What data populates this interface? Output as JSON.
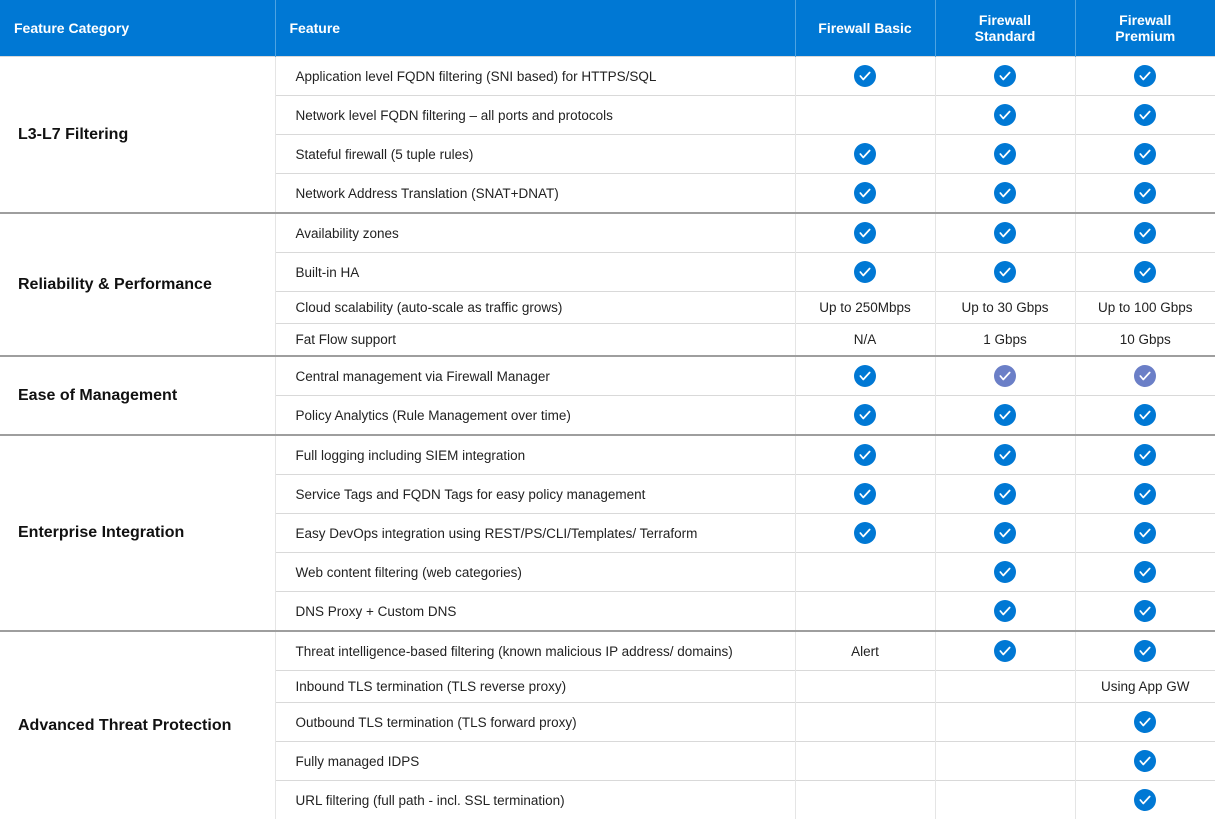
{
  "headers": {
    "category": "Feature Category",
    "feature": "Feature",
    "tier_basic": "Firewall Basic",
    "tier_standard": "Firewall Standard",
    "tier_premium": "Firewall Premium"
  },
  "groups": [
    {
      "category": "L3-L7 Filtering",
      "rows": [
        {
          "feature": "Application level FQDN filtering (SNI based) for HTTPS/SQL",
          "basic": "check",
          "standard": "check",
          "premium": "check"
        },
        {
          "feature": "Network level FQDN filtering – all ports and protocols",
          "basic": "",
          "standard": "check",
          "premium": "check"
        },
        {
          "feature": "Stateful firewall (5 tuple rules)",
          "basic": "check",
          "standard": "check",
          "premium": "check"
        },
        {
          "feature": "Network Address Translation (SNAT+DNAT)",
          "basic": "check",
          "standard": "check",
          "premium": "check"
        }
      ]
    },
    {
      "category": "Reliability & Performance",
      "rows": [
        {
          "feature": "Availability zones",
          "basic": "check",
          "standard": "check",
          "premium": "check"
        },
        {
          "feature": "Built-in  HA",
          "basic": "check",
          "standard": "check",
          "premium": "check"
        },
        {
          "feature": "Cloud scalability (auto-scale as traffic grows)",
          "basic": "Up to 250Mbps",
          "standard": "Up to 30 Gbps",
          "premium": "Up to 100 Gbps"
        },
        {
          "feature": " Fat Flow support",
          "basic": "N/A",
          "standard": "1 Gbps",
          "premium": "10 Gbps"
        }
      ]
    },
    {
      "category": "Ease of Management",
      "rows": [
        {
          "feature": "Central management via Firewall Manager",
          "basic": "check",
          "standard": "check-alt",
          "premium": "check-alt"
        },
        {
          "feature": "Policy Analytics  (Rule Management over time)",
          "basic": "check",
          "standard": "check",
          "premium": "check"
        }
      ]
    },
    {
      "category": "Enterprise Integration",
      "rows": [
        {
          "feature": "Full logging including SIEM integration",
          "basic": "check",
          "standard": "check",
          "premium": "check"
        },
        {
          "feature": "Service Tags and FQDN Tags for easy policy management",
          "basic": "check",
          "standard": "check",
          "premium": "check"
        },
        {
          "feature": "Easy DevOps integration using REST/PS/CLI/Templates/ Terraform",
          "basic": "check",
          "standard": "check",
          "premium": "check"
        },
        {
          "feature": "Web content filtering (web categories)",
          "basic": "",
          "standard": "check",
          "premium": "check"
        },
        {
          "feature": "DNS Proxy + Custom DNS",
          "basic": "",
          "standard": "check",
          "premium": "check"
        }
      ]
    },
    {
      "category": "Advanced Threat Protection",
      "rows": [
        {
          "feature": "Threat intelligence-based filtering (known malicious IP address/ domains)",
          "basic": "Alert",
          "standard": "check",
          "premium": "check"
        },
        {
          "feature": "Inbound TLS termination (TLS reverse proxy)",
          "basic": "",
          "standard": "",
          "premium": "Using App GW"
        },
        {
          "feature": "Outbound TLS termination (TLS forward proxy)",
          "basic": "",
          "standard": "",
          "premium": "check"
        },
        {
          "feature": "Fully managed IDPS",
          "basic": "",
          "standard": "",
          "premium": "check"
        },
        {
          "feature": "URL filtering (full path - incl. SSL termination)",
          "basic": "",
          "standard": "",
          "premium": "check"
        }
      ]
    }
  ]
}
